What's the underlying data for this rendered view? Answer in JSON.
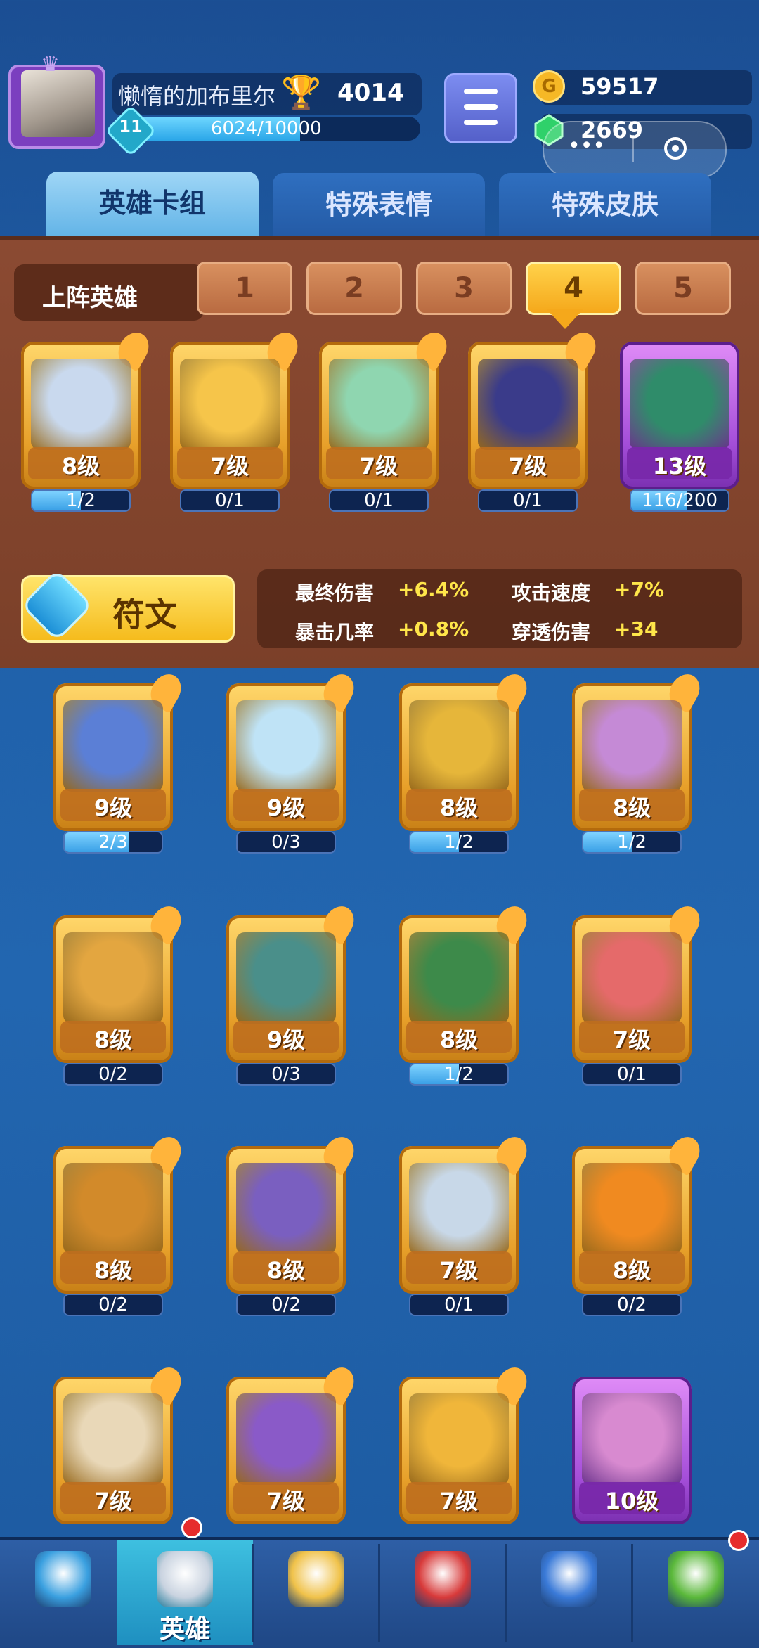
{
  "header": {
    "player_name": "懒惰的加布里尔",
    "trophies": "4014",
    "player_level": "11",
    "xp_text": "6024/10000",
    "xp_fraction": 0.6024,
    "gold": "59517",
    "gems": "2669"
  },
  "tabs": [
    {
      "label": "英雄卡组",
      "active": true
    },
    {
      "label": "特殊表情",
      "active": false
    },
    {
      "label": "特殊皮肤",
      "active": false
    }
  ],
  "lineup": {
    "label": "上阵英雄",
    "decks": [
      "1",
      "2",
      "3",
      "4",
      "5"
    ],
    "selected_deck": "4",
    "heroes": [
      {
        "level": "8级",
        "progress": "1/2",
        "fill": 0.5,
        "color": "#c9d9ee",
        "rarity": "gold"
      },
      {
        "level": "7级",
        "progress": "0/1",
        "fill": 0,
        "color": "#f6c54a",
        "rarity": "gold"
      },
      {
        "level": "7级",
        "progress": "0/1",
        "fill": 0,
        "color": "#8fd6b0",
        "rarity": "gold"
      },
      {
        "level": "7级",
        "progress": "0/1",
        "fill": 0,
        "color": "#3a3b8a",
        "rarity": "gold"
      },
      {
        "level": "13级",
        "progress": "116/200",
        "fill": 0.58,
        "color": "#2f8c6a",
        "rarity": "purple"
      }
    ]
  },
  "rune": {
    "label": "符文",
    "stats": [
      {
        "name": "最终伤害",
        "value": "+6.4%"
      },
      {
        "name": "攻击速度",
        "value": "+7%"
      },
      {
        "name": "暴击几率",
        "value": "+0.8%"
      },
      {
        "name": "穿透伤害",
        "value": "+34"
      }
    ]
  },
  "collection": [
    {
      "level": "9级",
      "progress": "2/3",
      "fill": 0.667,
      "color": "#5b7fd6",
      "rarity": "gold"
    },
    {
      "level": "9级",
      "progress": "0/3",
      "fill": 0,
      "color": "#bfe3f6",
      "rarity": "gold"
    },
    {
      "level": "8级",
      "progress": "1/2",
      "fill": 0.5,
      "color": "#e6b63a",
      "rarity": "gold"
    },
    {
      "level": "8级",
      "progress": "1/2",
      "fill": 0.5,
      "color": "#c58ad6",
      "rarity": "gold"
    },
    {
      "level": "8级",
      "progress": "0/2",
      "fill": 0,
      "color": "#e3a640",
      "rarity": "gold"
    },
    {
      "level": "9级",
      "progress": "0/3",
      "fill": 0,
      "color": "#4a8f8a",
      "rarity": "gold"
    },
    {
      "level": "8级",
      "progress": "1/2",
      "fill": 0.5,
      "color": "#3d8a4a",
      "rarity": "gold"
    },
    {
      "level": "7级",
      "progress": "0/1",
      "fill": 0,
      "color": "#e56a6a",
      "rarity": "gold"
    },
    {
      "level": "8级",
      "progress": "0/2",
      "fill": 0,
      "color": "#d28a2a",
      "rarity": "gold"
    },
    {
      "level": "8级",
      "progress": "0/2",
      "fill": 0,
      "color": "#7a5fc0",
      "rarity": "gold"
    },
    {
      "level": "7级",
      "progress": "0/1",
      "fill": 0,
      "color": "#c8d8e8",
      "rarity": "gold"
    },
    {
      "level": "8级",
      "progress": "0/2",
      "fill": 0,
      "color": "#f08a20",
      "rarity": "gold"
    },
    {
      "level": "7级",
      "progress": "",
      "fill": 0,
      "color": "#e9d8b8",
      "rarity": "gold"
    },
    {
      "level": "7级",
      "progress": "",
      "fill": 0,
      "color": "#8a5ac8",
      "rarity": "gold"
    },
    {
      "level": "7级",
      "progress": "",
      "fill": 0,
      "color": "#f0b63a",
      "rarity": "gold"
    },
    {
      "level": "10级",
      "progress": "",
      "fill": 0,
      "color": "#d88ad0",
      "rarity": "purple"
    }
  ],
  "bottom_nav": [
    {
      "icon": "treasure-chest-icon",
      "label": "",
      "color": "#3aa0e0"
    },
    {
      "icon": "knight-helmet-icon",
      "label": "英雄",
      "color": "#c9d3e0",
      "active": true
    },
    {
      "icon": "crossed-swords-icon",
      "label": "",
      "color": "#f0c24a"
    },
    {
      "icon": "crown-shield-icon",
      "label": "",
      "color": "#d83a3a"
    },
    {
      "icon": "team-banner-icon",
      "label": "",
      "color": "#3a7ad8"
    },
    {
      "icon": "sprout-island-icon",
      "label": "",
      "color": "#5ab83a"
    }
  ]
}
